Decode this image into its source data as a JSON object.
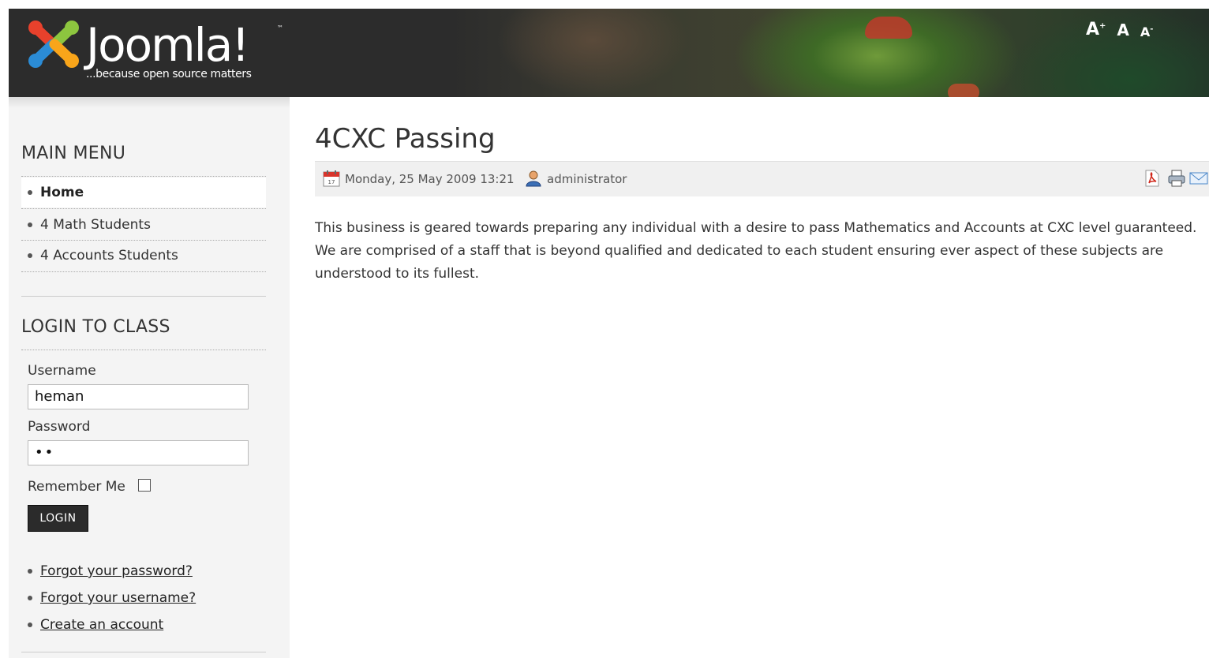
{
  "header": {
    "logo_text": "Joomla!",
    "logo_tm": "™",
    "tagline": "...because open source matters",
    "font_size_controls": {
      "increase": "A",
      "increase_sup": "+",
      "reset": "A",
      "decrease": "A",
      "decrease_sup": "-"
    }
  },
  "sidebar": {
    "main_menu": {
      "title": "MAIN MENU",
      "items": [
        {
          "label": "Home",
          "active": true
        },
        {
          "label": "4 Math Students",
          "active": false
        },
        {
          "label": "4 Accounts Students",
          "active": false
        }
      ]
    },
    "login": {
      "title": "LOGIN TO CLASS",
      "username_label": "Username",
      "username_value": "heman",
      "password_label": "Password",
      "password_value": "••",
      "remember_label": "Remember Me",
      "remember_checked": false,
      "submit_label": "LOGIN",
      "links": [
        "Forgot your password?",
        "Forgot your username?",
        "Create an account"
      ]
    }
  },
  "article": {
    "title": "4CXC Passing",
    "date": "Monday, 25 May 2009 13:21",
    "author": "administrator",
    "body": "This business is geared towards preparing any individual with a desire to pass Mathematics and Accounts at CXC level guaranteed. We are comprised of a staff that is beyond qualified and dedicated to each student ensuring ever aspect of these subjects are understood to its fullest.",
    "icons": [
      "pdf-icon",
      "print-icon",
      "email-icon"
    ]
  },
  "colors": {
    "header_bg": "#2c2c2c",
    "sidebar_bg": "#f4f4f4",
    "meta_bar_bg": "#f0f0f0",
    "button_bg": "#2b2b2b",
    "logo_red": "#e8412c",
    "logo_green": "#8dc63f",
    "logo_blue": "#2b8cd6",
    "logo_orange": "#f9a51a"
  }
}
